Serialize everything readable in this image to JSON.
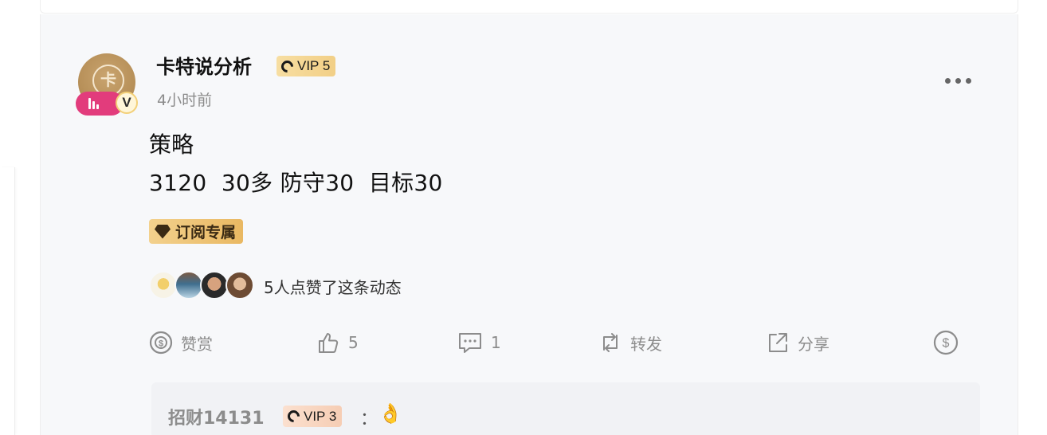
{
  "post": {
    "author": "卡特说分析",
    "vip_level": "VIP 5",
    "verified_mark": "V",
    "time_ago": "4小时前",
    "title": "策略",
    "body": "3120  30多 防守30  目标30",
    "subscription_tag": "订阅专属",
    "likes_summary": "5人点赞了这条动态"
  },
  "actions": {
    "reward_label": "赞赏",
    "like_count": "5",
    "comment_count": "1",
    "repost_label": "转发",
    "share_label": "分享"
  },
  "comment": {
    "user": "招财14131",
    "vip_level": "VIP 3",
    "separator": "：",
    "content": "👌"
  },
  "colors": {
    "card_background": "#f7f8fa",
    "vip_gold": "#f2cf86",
    "live_pink": "#e23c7c",
    "muted_text": "#8c8c8c"
  }
}
